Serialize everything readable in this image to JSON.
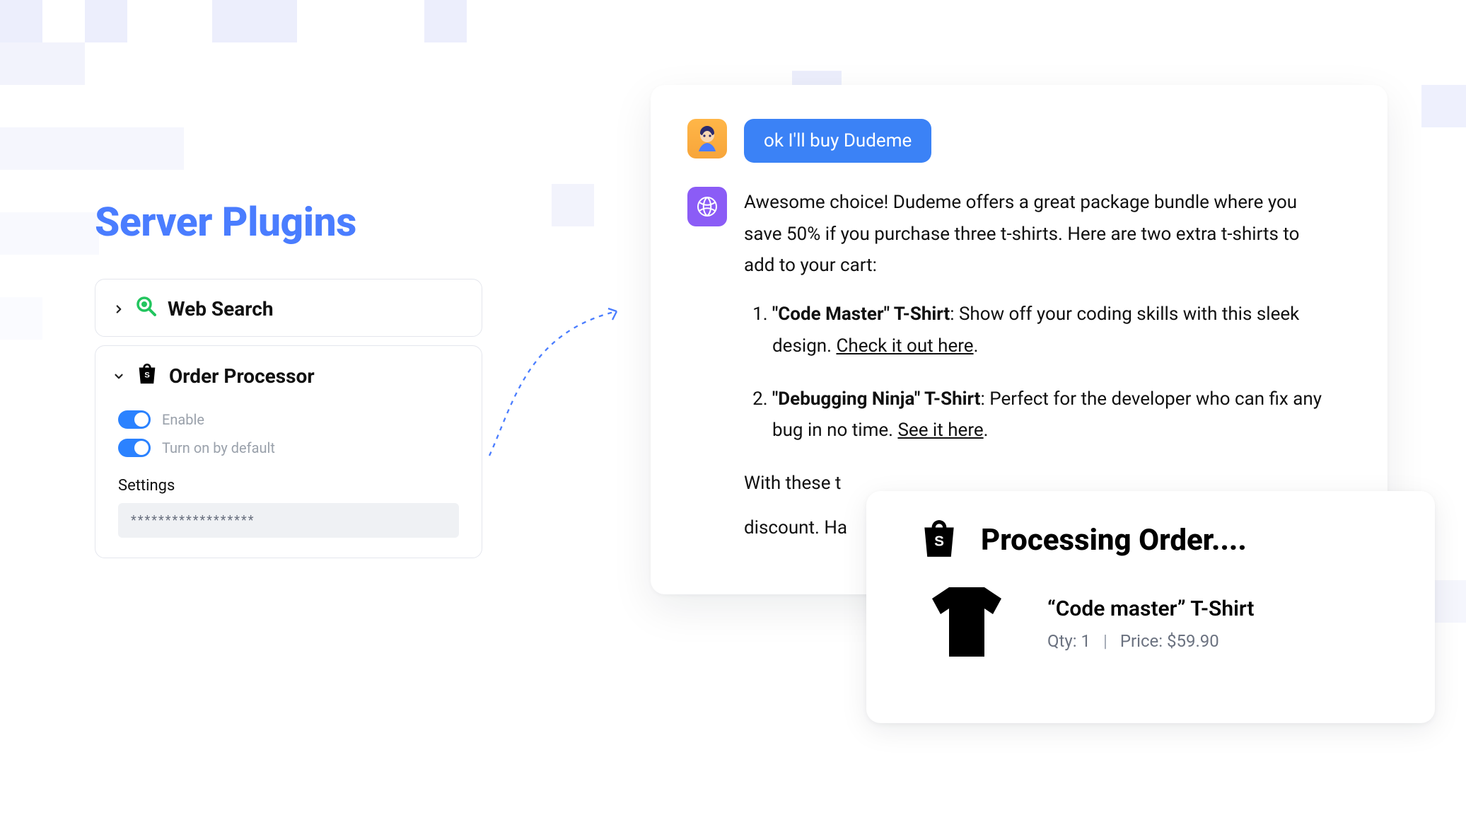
{
  "heading": "Server Plugins",
  "plugins": {
    "web_search": {
      "label": "Web Search"
    },
    "order_processor": {
      "label": "Order Processor",
      "enable_label": "Enable",
      "default_label": "Turn on by default",
      "settings_label": "Settings",
      "settings_value": "******************"
    }
  },
  "chat": {
    "user_message": "ok I'll buy Dudeme",
    "bot_intro": "Awesome choice! Dudeme offers a great package bundle where you save 50% if you purchase three t-shirts. Here are two extra t-shirts to add to your cart:",
    "items": [
      {
        "name": "\"Code Master\" T-Shirt",
        "desc": ": Show off your coding skills with this sleek design. ",
        "link": "Check it out here"
      },
      {
        "name": "\"Debugging Ninja\" T-Shirt",
        "desc": ": Perfect for the developer who can fix any bug in no time. ",
        "link": "See it here"
      }
    ],
    "truncated_a": "With these t",
    "truncated_b": "discount. Ha"
  },
  "order": {
    "processing_title": "Processing Order....",
    "product_name": "“Code master” T-Shirt",
    "qty_label": "Qty: 1",
    "price_label": "Price: $59.90"
  }
}
